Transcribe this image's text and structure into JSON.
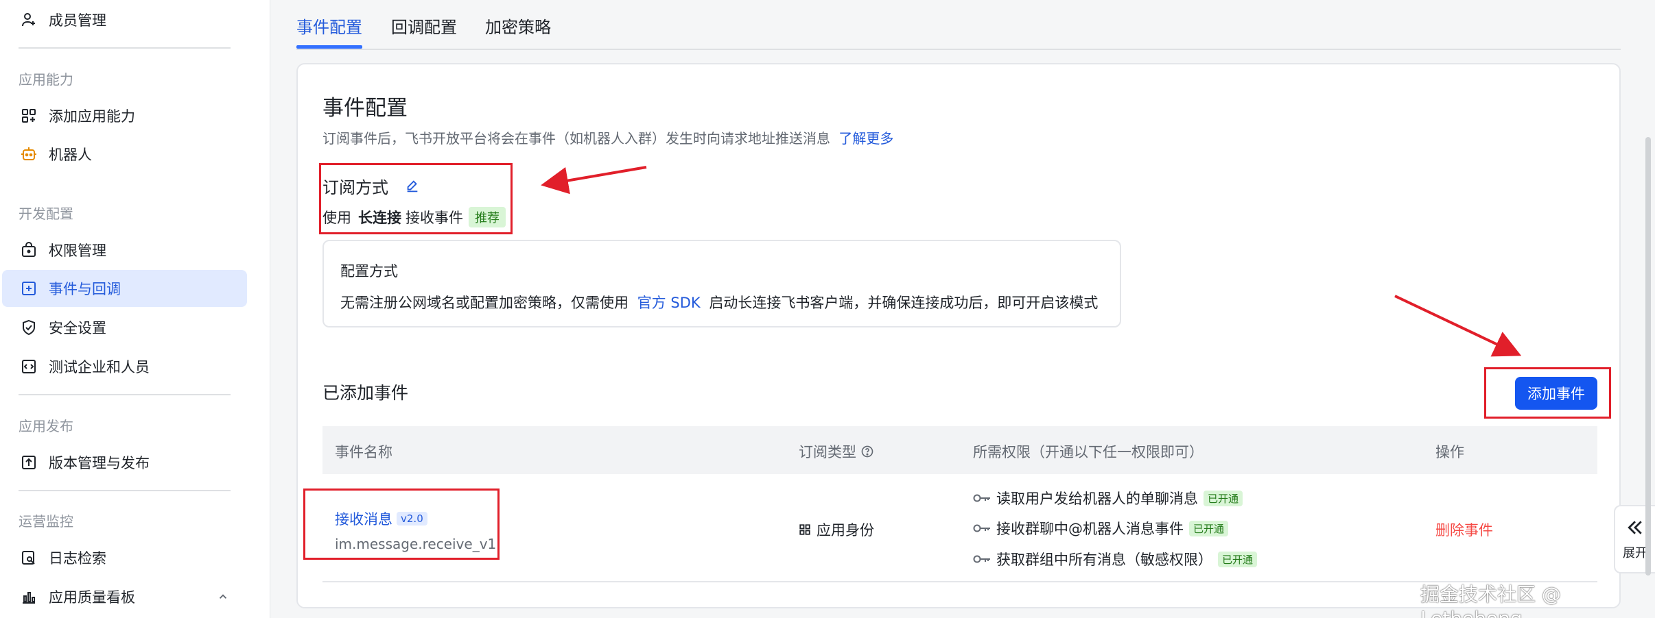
{
  "sidebar": {
    "member_mgmt": "成员管理",
    "section_app_ability": "应用能力",
    "add_app_ability": "添加应用能力",
    "robot": "机器人",
    "section_dev_config": "开发配置",
    "permission_mgmt": "权限管理",
    "events_callbacks": "事件与回调",
    "security_settings": "安全设置",
    "test_enterprise": "测试企业和人员",
    "section_release": "应用发布",
    "version_release": "版本管理与发布",
    "section_ops": "运营监控",
    "log_search": "日志检索",
    "quality_board": "应用质量看板"
  },
  "tabs": [
    "事件配置",
    "回调配置",
    "加密策略"
  ],
  "card": {
    "title": "事件配置",
    "description": "订阅事件后，飞书开放平台将会在事件（如机器人入群）发生时向请求地址推送消息",
    "learn_more": "了解更多",
    "subscribe_title": "订阅方式",
    "use_prefix": "使用",
    "long_conn": "长连接",
    "receive_events": "接收事件",
    "recommended": "推荐",
    "config_title": "配置方式",
    "config_desc_1": "无需注册公网域名或配置加密策略，仅需使用",
    "config_sdk": "官方 SDK",
    "config_desc_2": "启动长连接飞书客户端，并确保连接成功后，即可开启该模式",
    "added_events": "已添加事件",
    "add_event_btn": "添加事件"
  },
  "table": {
    "col_name": "事件名称",
    "col_type": "订阅类型",
    "col_perms": "所需权限（开通以下任一权限即可）",
    "col_action": "操作",
    "rows": [
      {
        "name": "接收消息",
        "version": "v2.0",
        "code": "im.message.receive_v1",
        "type": "应用身份",
        "permissions": [
          {
            "label": "读取用户发给机器人的单聊消息",
            "status": "已开通"
          },
          {
            "label": "接收群聊中@机器人消息事件",
            "status": "已开通"
          },
          {
            "label": "获取群组中所有消息（敏感权限）",
            "status": "已开通"
          }
        ],
        "action": "删除事件"
      }
    ]
  },
  "float": {
    "expand": "展开"
  },
  "watermark": "掘金技术社区 @ Lethehong",
  "colors": {
    "accent": "#245bdb",
    "primary_button": "#1456f0",
    "danger": "#f54a45",
    "annotation": "#e11f2a"
  }
}
